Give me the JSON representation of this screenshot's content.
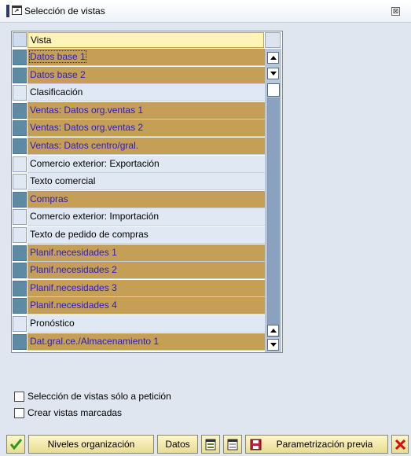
{
  "window": {
    "title": "Selección de vistas",
    "close_glyph": "⊠",
    "title_icon": "dialog-icon"
  },
  "table": {
    "column_header": "Vista",
    "rows": [
      {
        "label": "Datos base 1",
        "selected": true,
        "focused": true
      },
      {
        "label": "Datos base 2",
        "selected": true
      },
      {
        "label": "Clasificación",
        "selected": false
      },
      {
        "label": "Ventas: Datos org.ventas 1",
        "selected": true
      },
      {
        "label": "Ventas: Datos org.ventas 2",
        "selected": true
      },
      {
        "label": "Ventas: Datos centro/gral.",
        "selected": true
      },
      {
        "label": "Comercio exterior: Exportación",
        "selected": false
      },
      {
        "label": "Texto comercial",
        "selected": false
      },
      {
        "label": "Compras",
        "selected": true
      },
      {
        "label": "Comercio exterior: Importación",
        "selected": false
      },
      {
        "label": "Texto de pedido de compras",
        "selected": false
      },
      {
        "label": "Planif.necesidades 1",
        "selected": true
      },
      {
        "label": "Planif.necesidades 2",
        "selected": true
      },
      {
        "label": "Planif.necesidades 3",
        "selected": true
      },
      {
        "label": "Planif.necesidades 4",
        "selected": true
      },
      {
        "label": "Pronóstico",
        "selected": false
      },
      {
        "label": "Dat.gral.ce./Almacenamiento 1",
        "selected": true
      }
    ]
  },
  "options": {
    "only_on_request": {
      "label": "Selección de vistas sólo a petición",
      "checked": false
    },
    "create_marked": {
      "label": "Crear vistas marcadas",
      "checked": false
    }
  },
  "toolbar": {
    "org_levels_label": "Niveles organización",
    "data_label": "Datos",
    "default_values_label": "Parametrización previa"
  },
  "colors": {
    "selected_row_bg": "#c59f56",
    "selected_row_text": "#2a1ad1",
    "unselected_row_bg": "#dfe8f3",
    "header_bg": "#fff4b8",
    "confirm_green": "#2e9a1c",
    "cancel_red": "#d01010"
  }
}
